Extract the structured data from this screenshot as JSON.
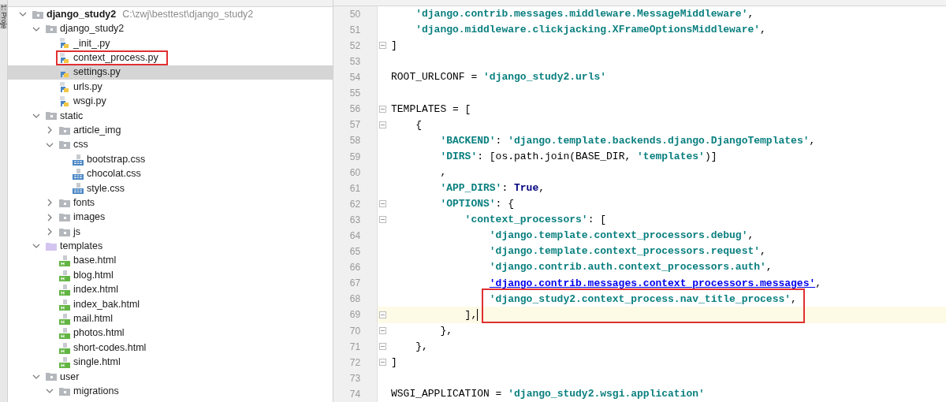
{
  "side_strip": {
    "label": "1: Proje"
  },
  "project_tree": [
    {
      "label": "django_study2",
      "path": "C:\\zwj\\besttest\\django_study2",
      "kind": "project",
      "expanded": true,
      "selected": false,
      "boxed": false,
      "children": [
        {
          "label": "django_study2",
          "kind": "folder",
          "expanded": true,
          "selected": false,
          "boxed": false,
          "children": [
            {
              "label": "_init_.py",
              "kind": "python",
              "selected": false,
              "boxed": false
            },
            {
              "label": "context_process.py",
              "kind": "python",
              "selected": false,
              "boxed": true
            },
            {
              "label": "settings.py",
              "kind": "python",
              "selected": true,
              "boxed": false
            },
            {
              "label": "urls.py",
              "kind": "python",
              "selected": false,
              "boxed": false
            },
            {
              "label": "wsgi.py",
              "kind": "python",
              "selected": false,
              "boxed": false
            }
          ]
        },
        {
          "label": "static",
          "kind": "folder",
          "expanded": true,
          "selected": false,
          "boxed": false,
          "children": [
            {
              "label": "article_img",
              "kind": "folder",
              "expanded": false,
              "selected": false,
              "boxed": false
            },
            {
              "label": "css",
              "kind": "folder",
              "expanded": true,
              "selected": false,
              "boxed": false,
              "children": [
                {
                  "label": "bootstrap.css",
                  "kind": "css",
                  "selected": false,
                  "boxed": false
                },
                {
                  "label": "chocolat.css",
                  "kind": "css",
                  "selected": false,
                  "boxed": false
                },
                {
                  "label": "style.css",
                  "kind": "css",
                  "selected": false,
                  "boxed": false
                }
              ]
            },
            {
              "label": "fonts",
              "kind": "folder",
              "expanded": false,
              "selected": false,
              "boxed": false
            },
            {
              "label": "images",
              "kind": "folder",
              "expanded": false,
              "selected": false,
              "boxed": false
            },
            {
              "label": "js",
              "kind": "folder",
              "expanded": false,
              "selected": false,
              "boxed": false
            }
          ]
        },
        {
          "label": "templates",
          "kind": "templates-folder",
          "expanded": true,
          "selected": false,
          "boxed": false,
          "children": [
            {
              "label": "base.html",
              "kind": "html",
              "selected": false,
              "boxed": false
            },
            {
              "label": "blog.html",
              "kind": "html",
              "selected": false,
              "boxed": false
            },
            {
              "label": "index.html",
              "kind": "html",
              "selected": false,
              "boxed": false
            },
            {
              "label": "index_bak.html",
              "kind": "html",
              "selected": false,
              "boxed": false
            },
            {
              "label": "mail.html",
              "kind": "html",
              "selected": false,
              "boxed": false
            },
            {
              "label": "photos.html",
              "kind": "html",
              "selected": false,
              "boxed": false
            },
            {
              "label": "short-codes.html",
              "kind": "html",
              "selected": false,
              "boxed": false
            },
            {
              "label": "single.html",
              "kind": "html",
              "selected": false,
              "boxed": false
            }
          ]
        },
        {
          "label": "user",
          "kind": "folder",
          "expanded": true,
          "selected": false,
          "boxed": false,
          "children": [
            {
              "label": "migrations",
              "kind": "folder",
              "expanded": true,
              "selected": false,
              "boxed": false
            }
          ]
        }
      ]
    }
  ],
  "code_lines": [
    {
      "number": "50",
      "fold": false,
      "current": false,
      "tokens": [
        {
          "kind": "string",
          "text": "'django.contrib.messages.middleware.MessageMiddleware'"
        },
        {
          "kind": "plain",
          "text": ","
        }
      ]
    },
    {
      "number": "51",
      "fold": false,
      "current": false,
      "tokens": [
        {
          "kind": "string",
          "text": "'django.middleware.clickjacking.XFrameOptionsMiddleware'"
        },
        {
          "kind": "plain",
          "text": ","
        }
      ]
    },
    {
      "number": "52",
      "fold": true,
      "current": false,
      "tokens": [
        {
          "kind": "plain",
          "text": "]"
        }
      ]
    },
    {
      "number": "53",
      "fold": false,
      "current": false
    },
    {
      "number": "54",
      "fold": false,
      "current": false,
      "tokens": [
        {
          "kind": "plain",
          "text": "ROOT_URLCONF = "
        },
        {
          "kind": "string",
          "text": "'django_study2.urls'"
        }
      ]
    },
    {
      "number": "55",
      "fold": false,
      "current": false
    },
    {
      "number": "56",
      "fold": true,
      "current": false,
      "tokens": [
        {
          "kind": "plain",
          "text": "TEMPLATES = ["
        }
      ]
    },
    {
      "number": "57",
      "fold": true,
      "current": false,
      "tokens": [
        {
          "kind": "plain",
          "text": "{"
        }
      ]
    },
    {
      "number": "58",
      "fold": false,
      "current": false,
      "tokens": [
        {
          "kind": "string",
          "text": "'BACKEND'"
        },
        {
          "kind": "plain",
          "text": ": "
        },
        {
          "kind": "string",
          "text": "'django.template.backends.django.DjangoTemplates'"
        },
        {
          "kind": "plain",
          "text": ","
        }
      ]
    },
    {
      "number": "59",
      "fold": false,
      "current": false,
      "tokens": [
        {
          "kind": "string",
          "text": "'DIRS'"
        },
        {
          "kind": "plain",
          "text": ": [os.path.join(BASE_DIR, "
        },
        {
          "kind": "string",
          "text": "'templates'"
        },
        {
          "kind": "plain",
          "text": ")]"
        }
      ]
    },
    {
      "number": "60",
      "fold": false,
      "current": false,
      "tokens": [
        {
          "kind": "plain",
          "text": ","
        }
      ]
    },
    {
      "number": "61",
      "fold": false,
      "current": false,
      "tokens": [
        {
          "kind": "string",
          "text": "'APP_DIRS'"
        },
        {
          "kind": "plain",
          "text": ": "
        },
        {
          "kind": "keyword",
          "text": "True"
        },
        {
          "kind": "plain",
          "text": ","
        }
      ]
    },
    {
      "number": "62",
      "fold": true,
      "current": false,
      "tokens": [
        {
          "kind": "string",
          "text": "'OPTIONS'"
        },
        {
          "kind": "plain",
          "text": ": {"
        }
      ]
    },
    {
      "number": "63",
      "fold": true,
      "current": false,
      "tokens": [
        {
          "kind": "string",
          "text": "'context_processors'"
        },
        {
          "kind": "plain",
          "text": ": ["
        }
      ]
    },
    {
      "number": "64",
      "fold": false,
      "current": false,
      "tokens": [
        {
          "kind": "string",
          "text": "'django.template.context_processors.debug'"
        },
        {
          "kind": "plain",
          "text": ","
        }
      ]
    },
    {
      "number": "65",
      "fold": false,
      "current": false,
      "tokens": [
        {
          "kind": "string",
          "text": "'django.template.context_processors.request'"
        },
        {
          "kind": "plain",
          "text": ","
        }
      ]
    },
    {
      "number": "66",
      "fold": false,
      "current": false,
      "tokens": [
        {
          "kind": "string",
          "text": "'django.contrib.auth.context_processors.auth'"
        },
        {
          "kind": "plain",
          "text": ","
        }
      ]
    },
    {
      "number": "67",
      "fold": false,
      "current": false,
      "tokens": [
        {
          "kind": "link",
          "text": "'django.contrib.messages.context_processors.messages'"
        },
        {
          "kind": "plain",
          "text": ","
        }
      ]
    },
    {
      "number": "68",
      "fold": false,
      "current": false,
      "tokens": [
        {
          "kind": "boxed-string",
          "text": "'django_study2.context_process.nav_title_process'"
        },
        {
          "kind": "plain",
          "text": ","
        }
      ]
    },
    {
      "number": "69",
      "fold": true,
      "current": true,
      "tokens": [
        {
          "kind": "plain",
          "text": "],"
        }
      ]
    },
    {
      "number": "70",
      "fold": true,
      "current": false,
      "tokens": [
        {
          "kind": "plain",
          "text": "},"
        }
      ]
    },
    {
      "number": "71",
      "fold": true,
      "current": false,
      "tokens": [
        {
          "kind": "plain",
          "text": "},"
        }
      ]
    },
    {
      "number": "72",
      "fold": true,
      "current": false,
      "tokens": [
        {
          "kind": "plain",
          "text": "]"
        }
      ]
    },
    {
      "number": "73",
      "fold": false,
      "current": false
    },
    {
      "number": "74",
      "fold": false,
      "current": false,
      "tokens": [
        {
          "kind": "plain",
          "text": "WSGI_APPLICATION = "
        },
        {
          "kind": "string",
          "text": "'django_study2.wsgi.application'"
        }
      ]
    }
  ]
}
